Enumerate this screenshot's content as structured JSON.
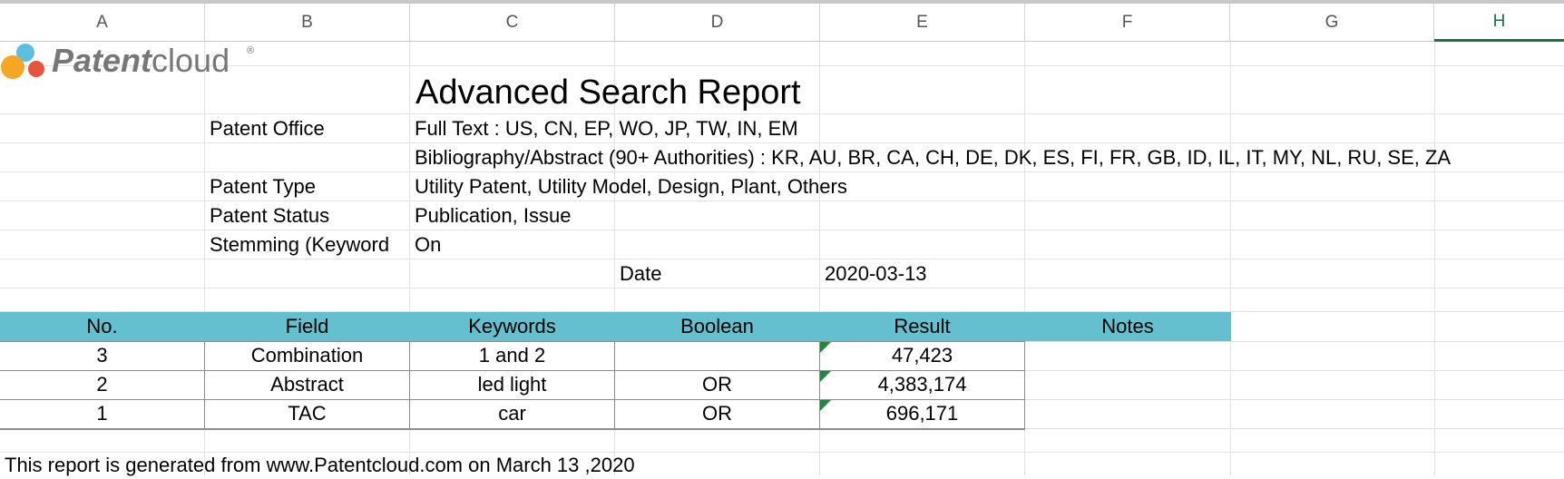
{
  "columns": [
    "A",
    "B",
    "C",
    "D",
    "E",
    "F",
    "G",
    "H"
  ],
  "active_column": "H",
  "logo": {
    "brand_bold": "Patent",
    "brand_light": "cloud",
    "reg": "®"
  },
  "report": {
    "title": "Advanced Search Report",
    "patent_office_label": "Patent Office",
    "patent_office_full_text": "Full Text : US, CN, EP, WO, JP, TW, IN, EM",
    "patent_office_biblio": "Bibliography/Abstract (90+ Authorities) : KR, AU, BR, CA, CH, DE, DK, ES, FI, FR, GB, ID, IL, IT, MY, NL, RU, SE, ZA",
    "patent_type_label": "Patent Type",
    "patent_type_value": "Utility Patent, Utility Model, Design, Plant, Others",
    "patent_status_label": "Patent Status",
    "patent_status_value": "Publication, Issue",
    "stemming_label": "Stemming (Keyword",
    "stemming_value": "On",
    "date_label": "Date",
    "date_value": "2020-03-13"
  },
  "table": {
    "headers": [
      "No.",
      "Field",
      "Keywords",
      "Boolean",
      "Result",
      "Notes"
    ],
    "rows": [
      {
        "no": "3",
        "field": "Combination",
        "keywords": "1 and 2",
        "boolean": "",
        "result": "47,423",
        "notes": ""
      },
      {
        "no": "2",
        "field": "Abstract",
        "keywords": "led light",
        "boolean": "OR",
        "result": "4,383,174",
        "notes": ""
      },
      {
        "no": "1",
        "field": "TAC",
        "keywords": "car",
        "boolean": "OR",
        "result": "696,171",
        "notes": ""
      }
    ]
  },
  "footer_note": "This report is generated from www.Patentcloud.com on March 13 ,2020",
  "colors": {
    "header_band": "#64c0cf",
    "active_column": "#1e7145",
    "comment_marker": "#1e8a3c"
  }
}
